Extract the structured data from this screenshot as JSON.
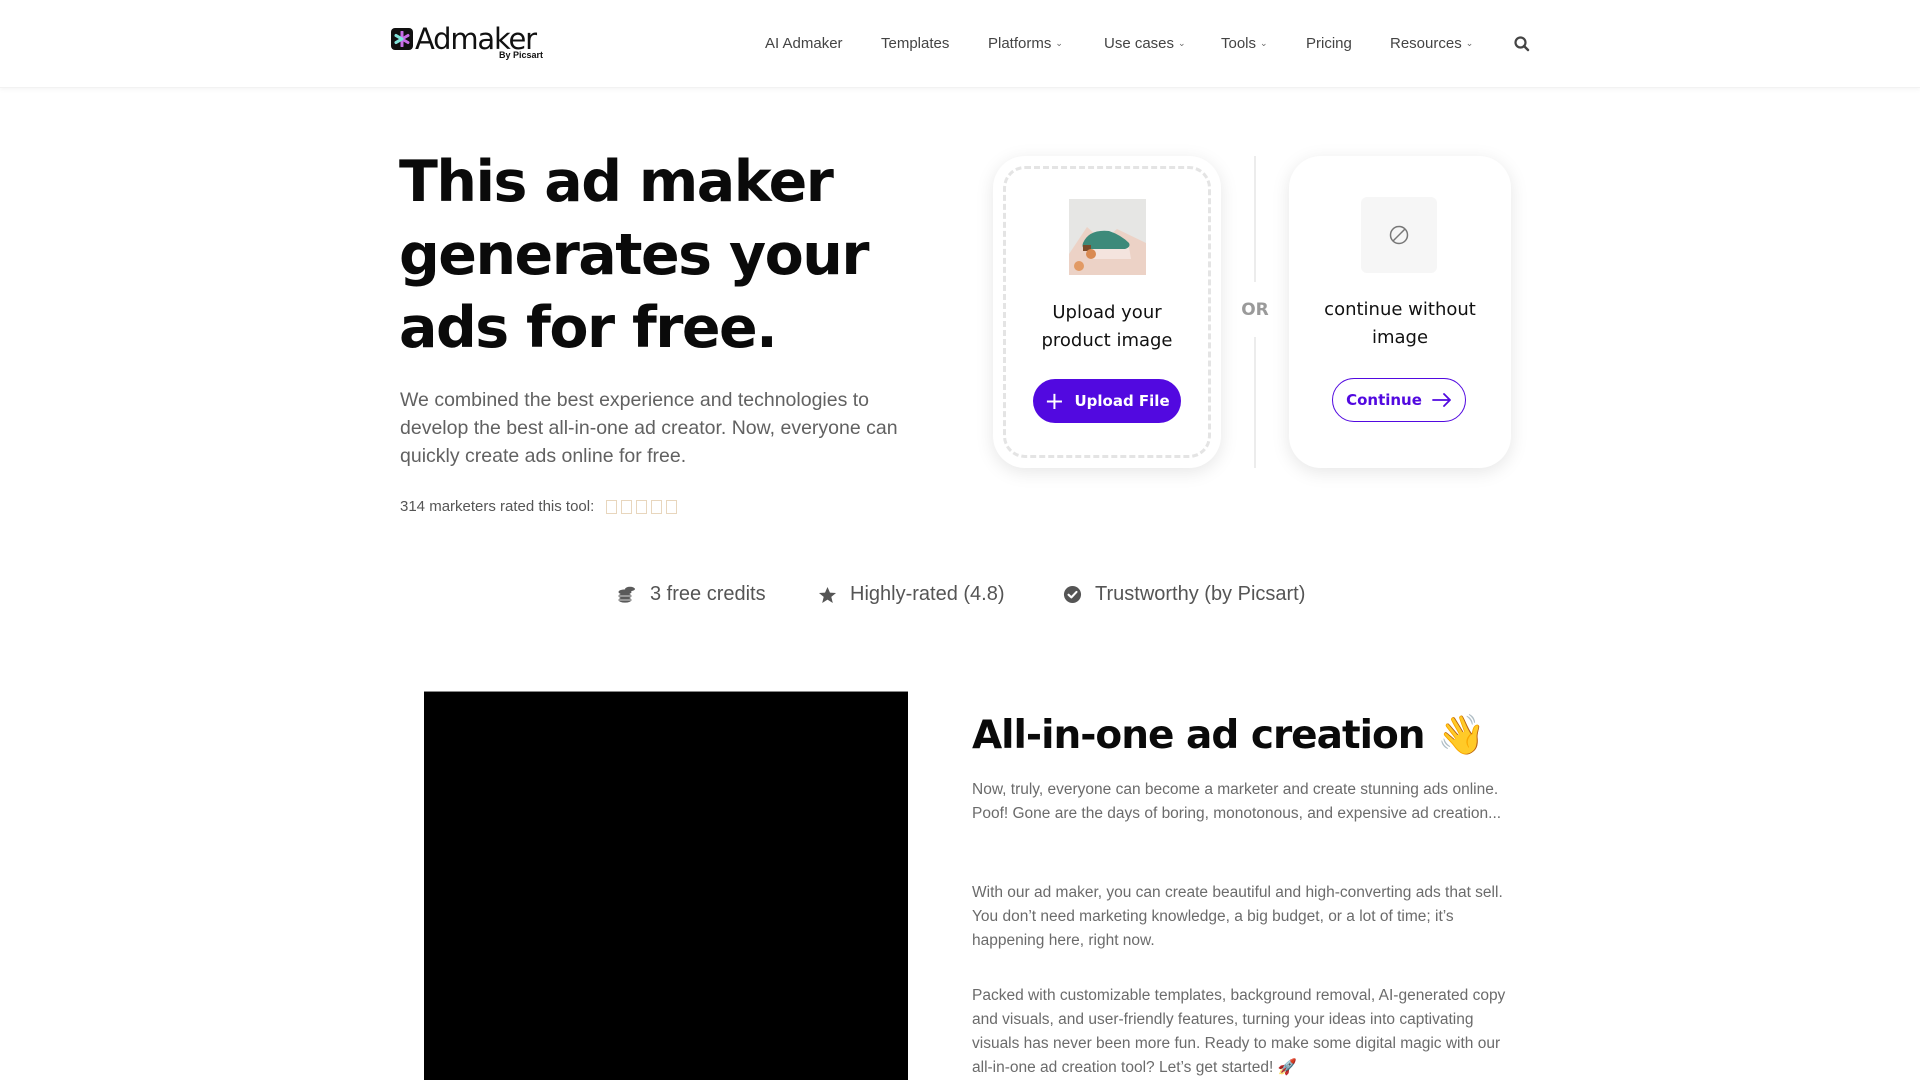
{
  "brand": {
    "name": "Admaker",
    "sub": "By Picsart",
    "accent": "#5209e0"
  },
  "nav": {
    "items": [
      {
        "label": "AI Admaker",
        "dropdown": false
      },
      {
        "label": "Templates",
        "dropdown": false
      },
      {
        "label": "Platforms",
        "dropdown": true
      },
      {
        "label": "Use cases",
        "dropdown": true
      },
      {
        "label": "Tools",
        "dropdown": true
      },
      {
        "label": "Pricing",
        "dropdown": false
      },
      {
        "label": "Resources",
        "dropdown": true
      }
    ],
    "search_icon": "search-icon"
  },
  "hero": {
    "title_lines": [
      "This ad maker",
      "generates your",
      "ads for free."
    ],
    "description": "We combined the best experience and technologies to develop the best all-in-one ad creator. Now, everyone can quickly create ads online for free.",
    "rating_text": "314 marketers rated this tool:",
    "rating_stars": 5
  },
  "upload": {
    "card_title": "Upload your product image",
    "button_label": "Upload File",
    "or_label": "OR",
    "continue_title": "continue without image",
    "continue_label": "Continue"
  },
  "badges": [
    {
      "icon": "coins-icon",
      "label": "3 free credits"
    },
    {
      "icon": "star-icon",
      "label": "Highly-rated (4.8)"
    },
    {
      "icon": "check-circle-icon",
      "label": "Trustworthy (by Picsart)"
    }
  ],
  "section": {
    "title": "All-in-one ad creation 👋",
    "paragraphs": [
      "Now, truly, everyone can become a marketer and create stunning ads online. Poof! Gone are the days of boring, monotonous, and expensive ad creation...",
      "With our ad maker, you can create beautiful and high-converting ads that sell. You don’t need marketing knowledge, a big budget, or a lot of time; it’s happening here, right now.",
      "Packed with customizable templates, background removal, AI-generated copy and visuals, and user-friendly features, turning your ideas into captivating visuals has never been more fun. Ready to make some digital magic with our all-in-one ad creation tool? Let’s get started! 🚀"
    ]
  }
}
